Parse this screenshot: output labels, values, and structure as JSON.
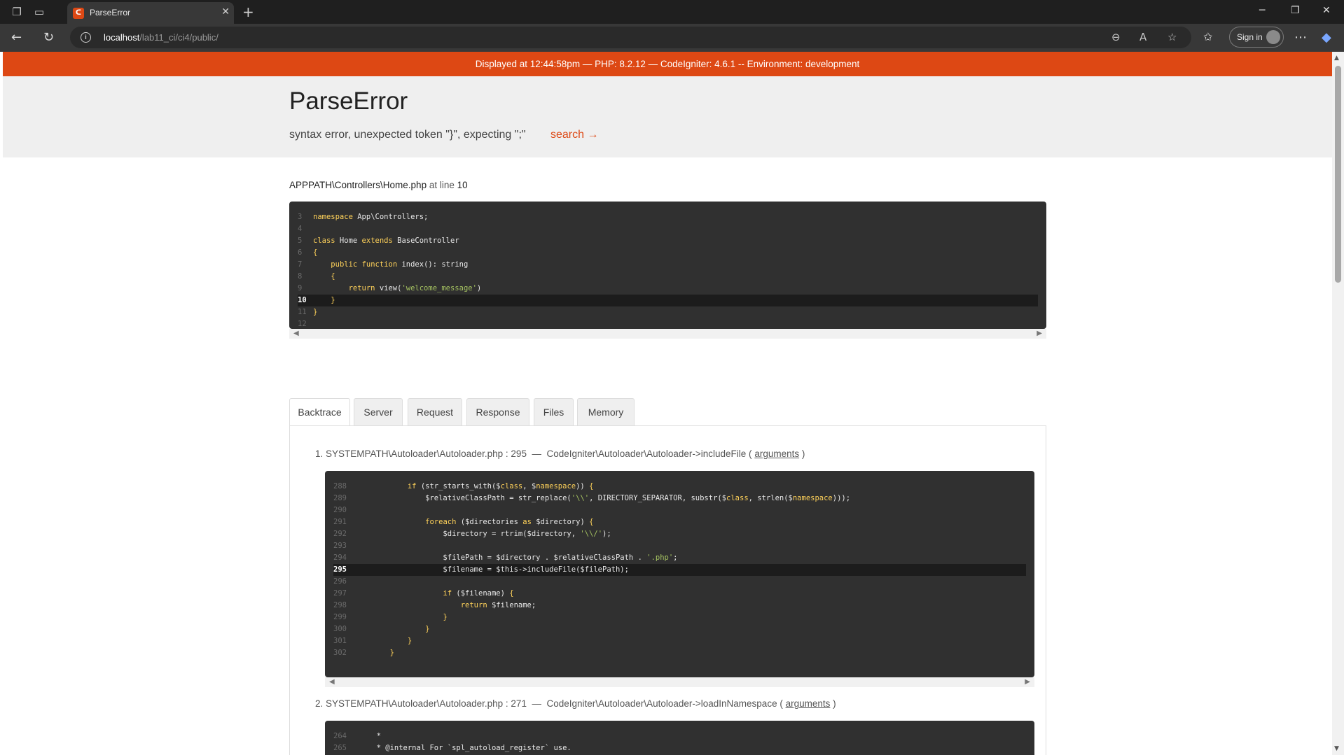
{
  "browser": {
    "tab_title": "ParseError",
    "tab_icon": "codeigniter-icon",
    "url_host": "localhost",
    "url_path": "/lab11_ci/ci4/public/",
    "signin_label": "Sign in"
  },
  "env_bar": {
    "text": "Displayed at 12:44:58pm — PHP: 8.2.12 — CodeIgniter: 4.6.1 -- Environment: development"
  },
  "error": {
    "title": "ParseError",
    "message": "syntax error, unexpected token \"}\", expecting \";\"",
    "search_link": "search →"
  },
  "source": {
    "path": "APPPATH\\Controllers\\Home.php",
    "at_line_label": "at line",
    "line": "10",
    "lines": [
      {
        "n": "3",
        "code": "namespace App\\Controllers;"
      },
      {
        "n": "4",
        "code": ""
      },
      {
        "n": "5",
        "code": "class Home extends BaseController"
      },
      {
        "n": "6",
        "code": "{"
      },
      {
        "n": "7",
        "code": "    public function index(): string"
      },
      {
        "n": "8",
        "code": "    {"
      },
      {
        "n": "9",
        "code": "        return view('welcome_message')"
      },
      {
        "n": "10",
        "code": "    }"
      },
      {
        "n": "11",
        "code": "}"
      },
      {
        "n": "12",
        "code": ""
      }
    ]
  },
  "tabs": [
    "Backtrace",
    "Server",
    "Request",
    "Response",
    "Files",
    "Memory"
  ],
  "backtrace": [
    {
      "index": "1.",
      "file": "SYSTEMPATH\\Autoloader\\Autoloader.php : 295",
      "sep": "—",
      "call": "CodeIgniter\\Autoloader\\Autoloader->includeFile (",
      "args": "arguments",
      "close": ")",
      "lines": [
        {
          "n": "288",
          "code": "            if (str_starts_with($class, $namespace)) {"
        },
        {
          "n": "289",
          "code": "                $relativeClassPath = str_replace('\\\\', DIRECTORY_SEPARATOR, substr($class, strlen($namespace)));"
        },
        {
          "n": "290",
          "code": ""
        },
        {
          "n": "291",
          "code": "                foreach ($directories as $directory) {"
        },
        {
          "n": "292",
          "code": "                    $directory = rtrim($directory, '\\\\/');"
        },
        {
          "n": "293",
          "code": ""
        },
        {
          "n": "294",
          "code": "                    $filePath = $directory . $relativeClassPath . '.php';"
        },
        {
          "n": "295",
          "code": "                    $filename = $this->includeFile($filePath);"
        },
        {
          "n": "296",
          "code": ""
        },
        {
          "n": "297",
          "code": "                    if ($filename) {"
        },
        {
          "n": "298",
          "code": "                        return $filename;"
        },
        {
          "n": "299",
          "code": "                    }"
        },
        {
          "n": "300",
          "code": "                }"
        },
        {
          "n": "301",
          "code": "            }"
        },
        {
          "n": "302",
          "code": "        }"
        }
      ]
    },
    {
      "index": "2.",
      "file": "SYSTEMPATH\\Autoloader\\Autoloader.php : 271",
      "sep": "—",
      "call": "CodeIgniter\\Autoloader\\Autoloader->loadInNamespace (",
      "args": "arguments",
      "close": ")",
      "lines": [
        {
          "n": "264",
          "code": "     *"
        },
        {
          "n": "265",
          "code": "     * @internal For `spl_autoload_register` use."
        }
      ]
    }
  ],
  "colors": {
    "accent": "#dd4814",
    "code_bg": "#303030",
    "keyword": "#ffd25a",
    "string": "#a5c261"
  }
}
